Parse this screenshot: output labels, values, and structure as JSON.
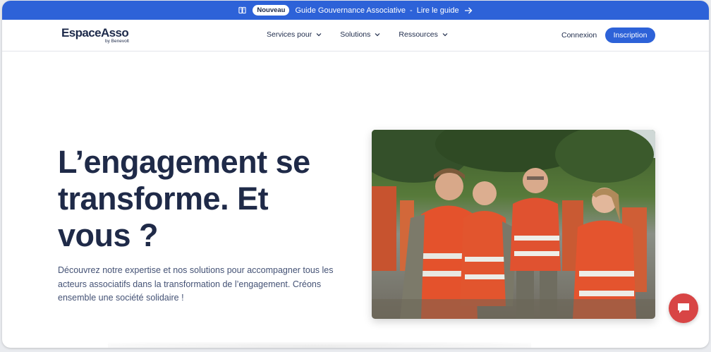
{
  "announcement": {
    "badge": "Nouveau",
    "title": "Guide Gouvernance Associative",
    "separator": "-",
    "link": "Lire le guide",
    "icon_left": "book-icon",
    "icon_right": "arrow-right-icon"
  },
  "header": {
    "logo": {
      "brand": "EspaceAsso",
      "byline": "by Benevolt"
    },
    "nav": [
      {
        "label": "Services pour"
      },
      {
        "label": "Solutions"
      },
      {
        "label": "Ressources"
      }
    ],
    "login": "Connexion",
    "signup": "Inscription"
  },
  "hero": {
    "title_line1": "L’engagement se",
    "title_line2": "transforme. Et",
    "title_line3": "vous ?",
    "description": "Découvrez notre expertise et nos solutions pour accompagner tous les acteurs associatifs dans la transformation de l’engagement. Créons ensemble une société solidaire !"
  },
  "chat": {
    "icon": "chat-bubble-icon"
  },
  "colors": {
    "primary": "#2d62d8",
    "heading": "#1f2a48",
    "text": "#445275",
    "chat": "#d84545"
  }
}
